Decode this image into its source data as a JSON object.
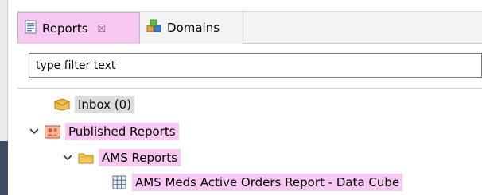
{
  "tabs": [
    {
      "label": "Reports",
      "icon": "report-document-icon",
      "close": "☒",
      "active": true
    },
    {
      "label": "Domains",
      "icon": "domains-cubes-icon",
      "active": false
    }
  ],
  "filter": {
    "value": "type filter text"
  },
  "tree": {
    "inbox": {
      "label": "Inbox (0)",
      "icon": "inbox-envelope-icon"
    },
    "published": {
      "label": "Published Reports",
      "icon": "published-users-icon",
      "expanded": true
    },
    "ams_folder": {
      "label": "AMS Reports",
      "icon": "folder-icon",
      "expanded": true
    },
    "report_item": {
      "label": "AMS Meds Active Orders Report - Data Cube",
      "icon": "grid-table-icon"
    }
  },
  "colors": {
    "highlight": "#f7c8f1",
    "selected": "#dcdcdc"
  }
}
